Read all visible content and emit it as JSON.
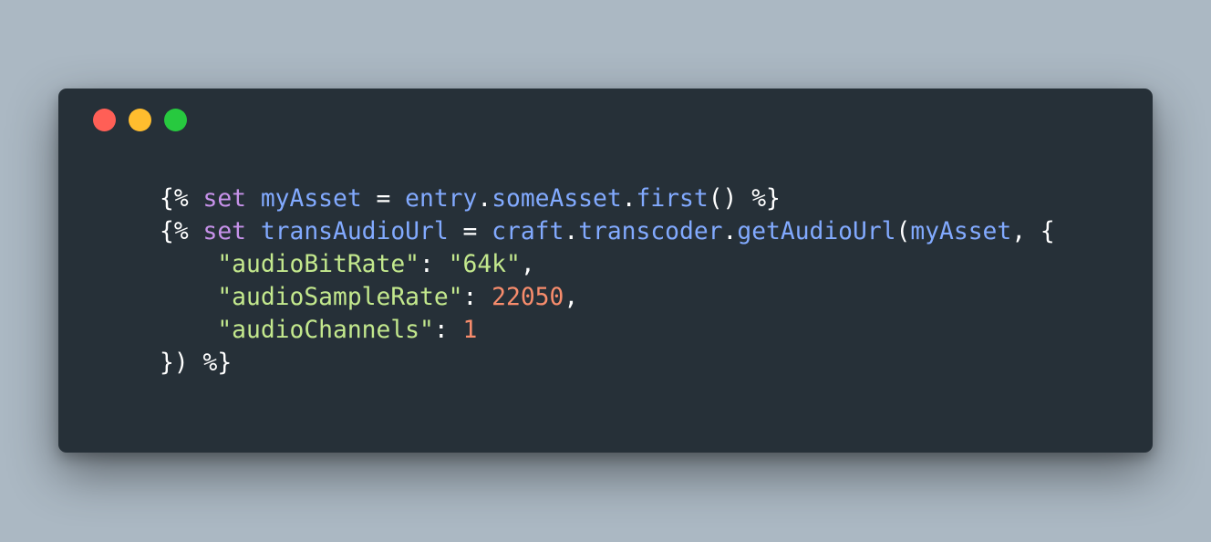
{
  "colors": {
    "background": "#abb8c3",
    "window": "#263038",
    "close_dot": "#ff5f56",
    "minimize_dot": "#ffbd2e",
    "zoom_dot": "#27c93f",
    "default_text": "#ffffff",
    "keyword": "#c792ea",
    "identifier": "#82aaff",
    "string": "#c3e88d",
    "number": "#f78c6c"
  },
  "window_controls": [
    {
      "name": "close",
      "color": "#ff5f56"
    },
    {
      "name": "minimize",
      "color": "#ffbd2e"
    },
    {
      "name": "zoom",
      "color": "#27c93f"
    }
  ],
  "code_lines": [
    [
      {
        "t": "{% ",
        "k": "default"
      },
      {
        "t": "set",
        "k": "keyword"
      },
      {
        "t": " ",
        "k": "default"
      },
      {
        "t": "myAsset",
        "k": "ident"
      },
      {
        "t": " = ",
        "k": "default"
      },
      {
        "t": "entry",
        "k": "ident"
      },
      {
        "t": ".",
        "k": "default"
      },
      {
        "t": "someAsset",
        "k": "ident"
      },
      {
        "t": ".",
        "k": "default"
      },
      {
        "t": "first",
        "k": "ident"
      },
      {
        "t": "() %}",
        "k": "default"
      }
    ],
    [
      {
        "t": "{% ",
        "k": "default"
      },
      {
        "t": "set",
        "k": "keyword"
      },
      {
        "t": " ",
        "k": "default"
      },
      {
        "t": "transAudioUrl",
        "k": "ident"
      },
      {
        "t": " = ",
        "k": "default"
      },
      {
        "t": "craft",
        "k": "ident"
      },
      {
        "t": ".",
        "k": "default"
      },
      {
        "t": "transcoder",
        "k": "ident"
      },
      {
        "t": ".",
        "k": "default"
      },
      {
        "t": "getAudioUrl",
        "k": "ident"
      },
      {
        "t": "(",
        "k": "default"
      },
      {
        "t": "myAsset",
        "k": "ident"
      },
      {
        "t": ", {",
        "k": "default"
      }
    ],
    [
      {
        "t": "    ",
        "k": "default"
      },
      {
        "t": "\"audioBitRate\"",
        "k": "string"
      },
      {
        "t": ": ",
        "k": "default"
      },
      {
        "t": "\"64k\"",
        "k": "string"
      },
      {
        "t": ",",
        "k": "default"
      }
    ],
    [
      {
        "t": "    ",
        "k": "default"
      },
      {
        "t": "\"audioSampleRate\"",
        "k": "string"
      },
      {
        "t": ": ",
        "k": "default"
      },
      {
        "t": "22050",
        "k": "number"
      },
      {
        "t": ",",
        "k": "default"
      }
    ],
    [
      {
        "t": "    ",
        "k": "default"
      },
      {
        "t": "\"audioChannels\"",
        "k": "string"
      },
      {
        "t": ": ",
        "k": "default"
      },
      {
        "t": "1",
        "k": "number"
      }
    ],
    [
      {
        "t": "}) %}",
        "k": "default"
      }
    ]
  ]
}
